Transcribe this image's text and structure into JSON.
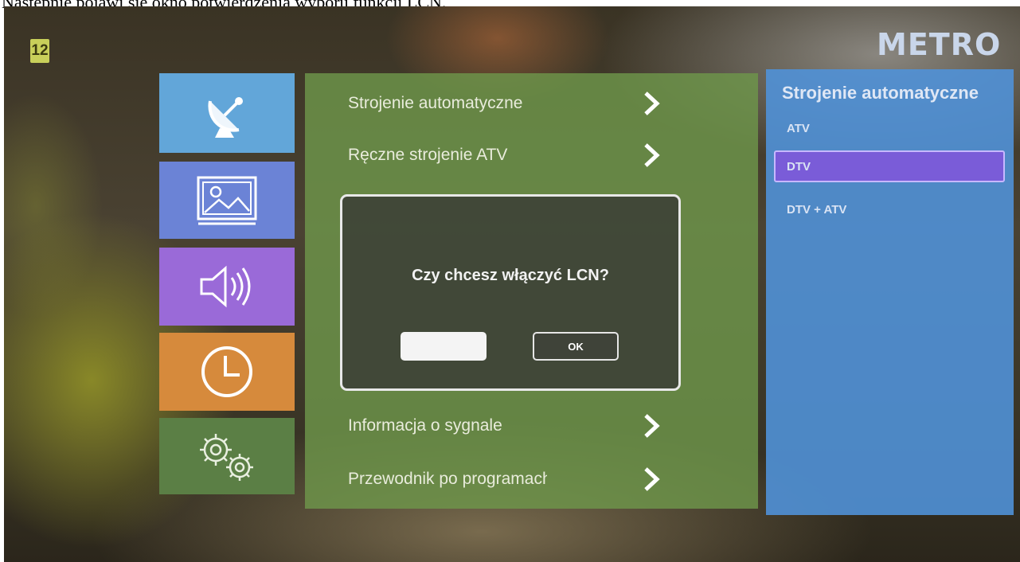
{
  "caption": "Następnie pojawi się okno potwierdzenia wyboru funkcji LCN.",
  "channel_number": "12",
  "brand": "METRO",
  "tiles": [
    {
      "name": "channels",
      "icon": "satellite-dish-icon",
      "color": "#62a6d9"
    },
    {
      "name": "picture",
      "icon": "picture-icon",
      "color": "#6b83d6"
    },
    {
      "name": "sound",
      "icon": "speaker-icon",
      "color": "#9a6ad8"
    },
    {
      "name": "time",
      "icon": "clock-icon",
      "color": "#d68a3c"
    },
    {
      "name": "settings",
      "icon": "gears-icon",
      "color": "#5b7f45"
    }
  ],
  "menu": {
    "items": [
      {
        "label": "Strojenie automatyczne"
      },
      {
        "label": "Ręczne strojenie ATV"
      },
      {
        "label": "Informacja o sygnale"
      },
      {
        "label": "Przewodnik po programach"
      }
    ]
  },
  "submenu": {
    "title": "Strojenie automatyczne",
    "options": [
      {
        "label": "ATV",
        "selected": false
      },
      {
        "label": "DTV",
        "selected": true
      },
      {
        "label": "DTV + ATV",
        "selected": false
      }
    ]
  },
  "dialog": {
    "message": "Czy chcesz włączyć LCN?",
    "cancel_label": "",
    "ok_label": "OK"
  }
}
